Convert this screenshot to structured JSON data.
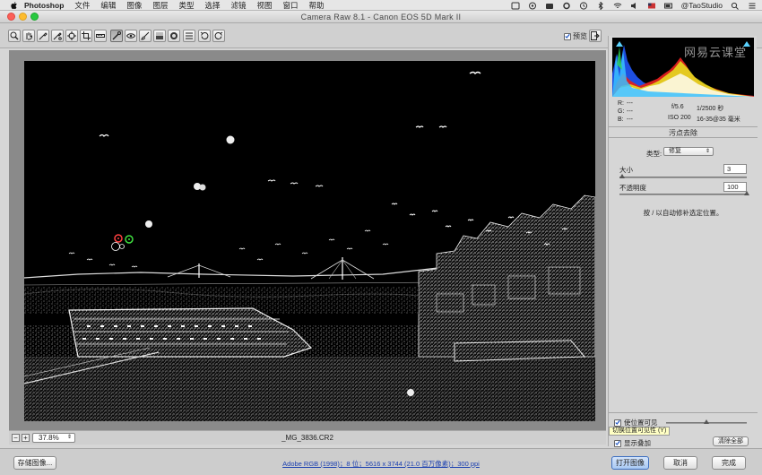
{
  "menubar": {
    "app": "Photoshop",
    "menus": [
      "文件",
      "编辑",
      "图像",
      "图层",
      "类型",
      "选择",
      "滤镜",
      "视图",
      "窗口",
      "帮助"
    ],
    "account": "@TaoStudio"
  },
  "window": {
    "title": "Camera Raw 8.1 -  Canon EOS 5D Mark II"
  },
  "toolbar": {
    "tools": [
      "zoom-icon",
      "hand-icon",
      "white-balance-icon",
      "color-sampler-icon",
      "targeted-adjustment-icon",
      "crop-icon",
      "straighten-icon",
      "spot-removal-icon",
      "red-eye-icon",
      "adjustment-brush-icon",
      "graduated-filter-icon",
      "radial-filter-icon",
      "preferences-icon",
      "rotate-ccw-icon",
      "rotate-cw-icon"
    ],
    "active_tool": "spot-removal-icon",
    "preview_label": "预览",
    "preview_checked": true
  },
  "canvas": {
    "zoom": "37.8%",
    "filename": "_MG_3836.CR2"
  },
  "histogram": {
    "watermark": "网易云课堂"
  },
  "readout": {
    "r_label": "R:",
    "r_value": "---",
    "g_label": "G:",
    "g_value": "---",
    "b_label": "B:",
    "b_value": "---",
    "aperture": "f/5.6",
    "shutter": "1/2500 秒",
    "iso": "ISO 200",
    "lens": "16-35@35 毫米"
  },
  "spot_removal": {
    "section_title": "污点去除",
    "type_label": "类型:",
    "type_value": "修复",
    "size_label": "大小",
    "size_value": "3",
    "size_level": 0.02,
    "opacity_label": "不透明度",
    "opacity_value": "100",
    "opacity_level": 1.0,
    "hint": "按 / 以自动修补选定位置。",
    "visualize_label": "使位置可见",
    "visualize_checked": true,
    "visualize_level": 0.5,
    "tooltip": "切换位置可见性 (Y)",
    "overlay_label": "显示叠加",
    "overlay_checked": true,
    "clear_all": "清除全部"
  },
  "bottombar": {
    "save": "存储图像...",
    "workflow": "Adobe RGB (1998)；8 位；5616 x 3744 (21.0 百万像素)；300 ppi",
    "open": "打开图像",
    "cancel": "取消",
    "done": "完成"
  },
  "colors": {
    "clip_warning": "#5bd2ff",
    "primary_button": "#a8c8f3",
    "spot_source": "#ff4040",
    "spot_target": "#40e040"
  }
}
